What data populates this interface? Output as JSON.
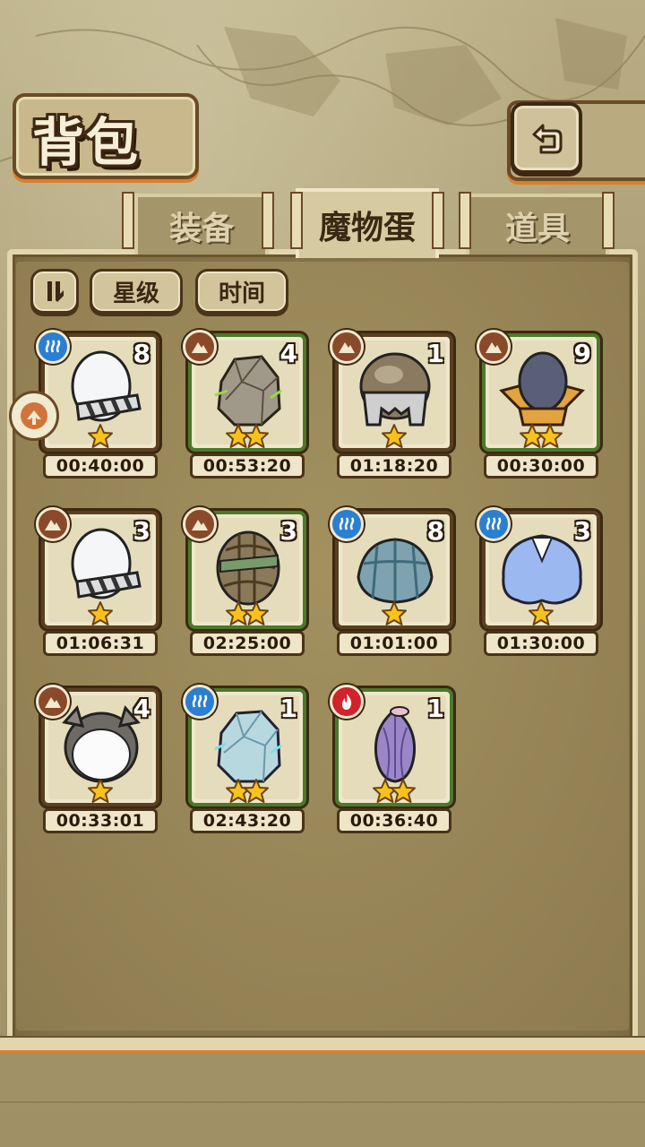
{
  "header": {
    "title": "背包"
  },
  "tabs": [
    {
      "label": "装备",
      "active": false
    },
    {
      "label": "魔物蛋",
      "active": true
    },
    {
      "label": "道具",
      "active": false
    }
  ],
  "filters": {
    "star_label": "星级",
    "time_label": "时间"
  },
  "eggs": [
    {
      "element": "water",
      "count": "8",
      "stars": 1,
      "frame": "brown",
      "time": "00:40:00",
      "art": "white-striped-egg"
    },
    {
      "element": "earth",
      "count": "4",
      "stars": 2,
      "frame": "green",
      "time": "00:53:20",
      "art": "stone-egg"
    },
    {
      "element": "earth",
      "count": "1",
      "stars": 1,
      "frame": "brown",
      "time": "01:18:20",
      "art": "helmet-egg"
    },
    {
      "element": "earth",
      "count": "9",
      "stars": 2,
      "frame": "green",
      "time": "00:30:00",
      "art": "hat-egg"
    },
    {
      "element": "earth",
      "count": "3",
      "stars": 1,
      "frame": "brown",
      "time": "01:06:31",
      "art": "white-striped-egg"
    },
    {
      "element": "earth",
      "count": "3",
      "stars": 2,
      "frame": "green",
      "time": "02:25:00",
      "art": "wrapped-egg"
    },
    {
      "element": "water",
      "count": "8",
      "stars": 1,
      "frame": "brown",
      "time": "01:01:00",
      "art": "shell-egg"
    },
    {
      "element": "water",
      "count": "3",
      "stars": 1,
      "frame": "brown",
      "time": "01:30:00",
      "art": "blue-fluffy-egg"
    },
    {
      "element": "earth",
      "count": "4",
      "stars": 1,
      "frame": "brown",
      "time": "00:33:01",
      "art": "koala-egg"
    },
    {
      "element": "water",
      "count": "1",
      "stars": 2,
      "frame": "green",
      "time": "02:43:20",
      "art": "crystal-egg"
    },
    {
      "element": "fire",
      "count": "1",
      "stars": 2,
      "frame": "green",
      "time": "00:36:40",
      "art": "flower-egg"
    }
  ],
  "colors": {
    "water": "#2b7fd0",
    "earth": "#8a4a2a",
    "fire": "#d2232a",
    "star": "#f7c21c"
  },
  "icons": {
    "back": "back-arrow-icon",
    "sort": "sort-toggle-icon",
    "star": "star-icon"
  }
}
